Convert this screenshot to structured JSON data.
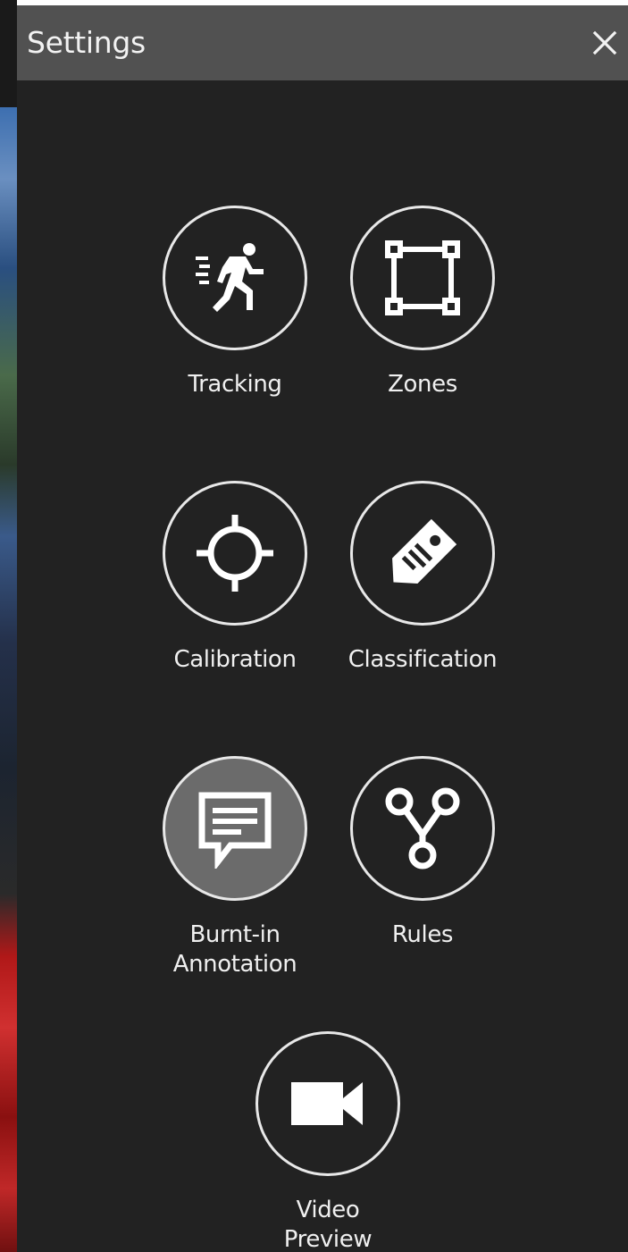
{
  "header": {
    "title": "Settings",
    "close_icon": "close-icon"
  },
  "tiles": [
    {
      "label": "Tracking",
      "icon": "running-person-icon",
      "active": false
    },
    {
      "label": "Zones",
      "icon": "bounding-box-icon",
      "active": false
    },
    {
      "label": "Calibration",
      "icon": "crosshair-icon",
      "active": false
    },
    {
      "label": "Classification",
      "icon": "tag-icon",
      "active": false
    },
    {
      "label": "Burnt-in\nAnnotation",
      "icon": "comment-icon",
      "active": true
    },
    {
      "label": "Rules",
      "icon": "branch-icon",
      "active": false
    },
    {
      "label": "Video\nPreview",
      "icon": "video-camera-icon",
      "active": false
    }
  ],
  "colors": {
    "panel_bg": "#222222",
    "header_bg": "#515151",
    "active_circle": "#6b6b6b",
    "foreground": "#f0f0f0"
  }
}
